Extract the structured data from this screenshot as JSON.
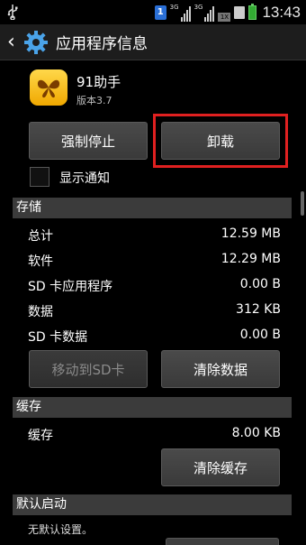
{
  "status_bar": {
    "sim1_badge": "1",
    "signal1_label": "3G",
    "signal2_label": "3G",
    "sim2_badge": "1X",
    "time": "13:43"
  },
  "header": {
    "title": "应用程序信息"
  },
  "app": {
    "name": "91助手",
    "version": "版本3.7"
  },
  "actions": {
    "force_stop": "强制停止",
    "uninstall": "卸载"
  },
  "notification": {
    "label": "显示通知",
    "checked": false
  },
  "storage": {
    "header": "存储",
    "rows": [
      {
        "label": "总计",
        "value": "12.59 MB"
      },
      {
        "label": "软件",
        "value": "12.29 MB"
      },
      {
        "label": "SD 卡应用程序",
        "value": "0.00 B"
      },
      {
        "label": "数据",
        "value": "312 KB"
      },
      {
        "label": "SD 卡数据",
        "value": "0.00 B"
      }
    ],
    "move_to_sd": "移动到SD卡",
    "clear_data": "清除数据"
  },
  "cache": {
    "header": "缓存",
    "label": "缓存",
    "value": "8.00 KB",
    "clear_cache": "清除缓存"
  },
  "default_launch": {
    "header": "默认启动",
    "text": "无默认设置。"
  },
  "colors": {
    "highlight": "#e02020",
    "section_bg": "#3b3b3b",
    "app_icon": "#f0a800"
  },
  "icons": {
    "usb": "usb-icon",
    "back": "back-arrow-icon",
    "settings": "gear-icon",
    "app": "butterfly-app-icon"
  }
}
